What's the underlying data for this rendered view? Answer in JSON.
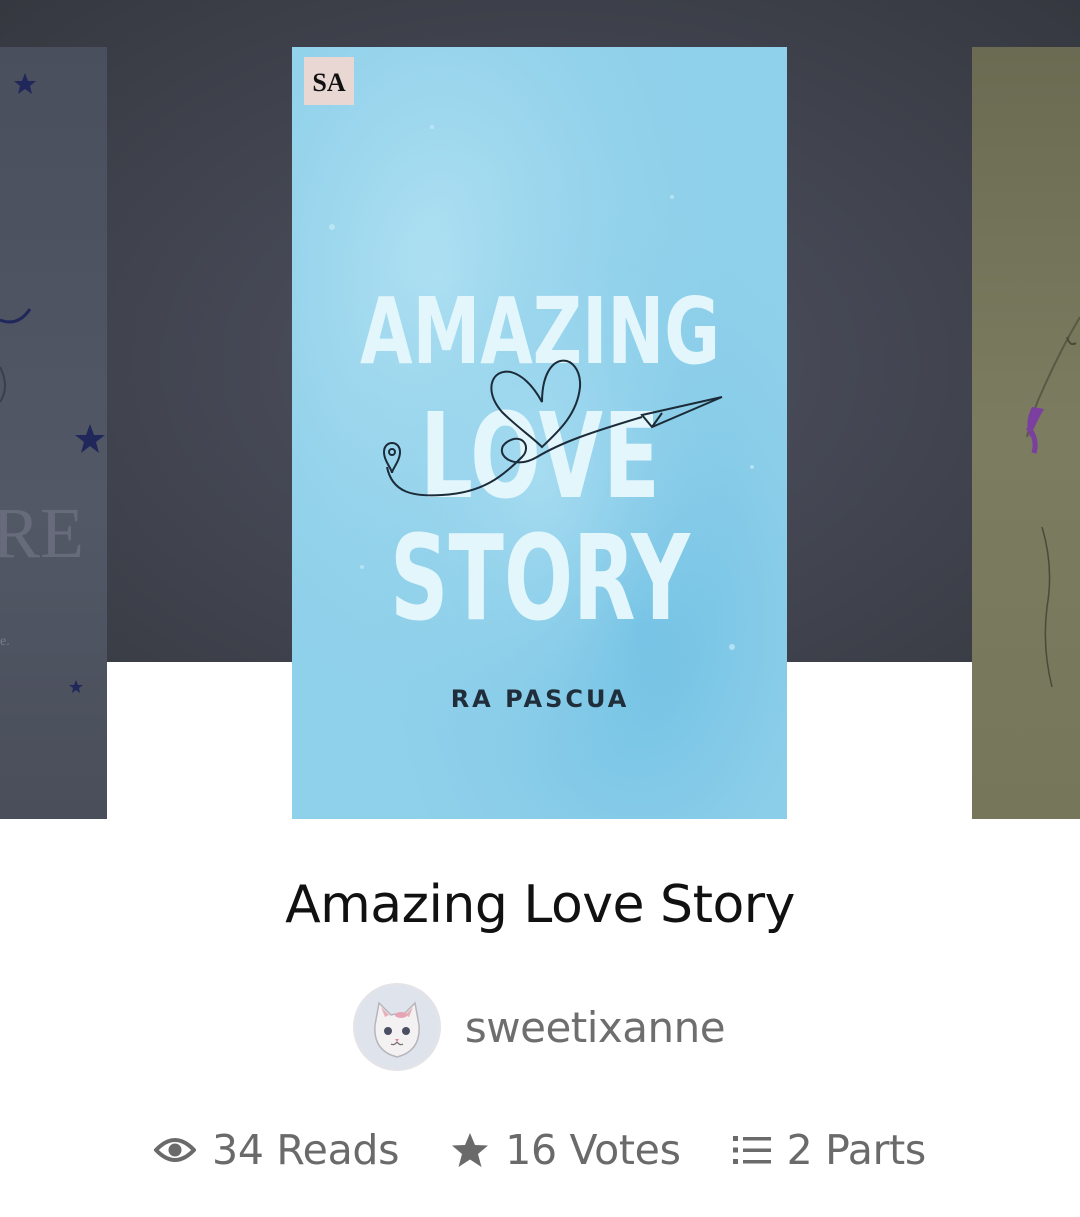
{
  "carousel": {
    "left_cover_fragment": "RE",
    "main_cover": {
      "publisher_badge": "SA",
      "cover_title_lines": [
        "AMAZING",
        "LOVE",
        "STORY"
      ],
      "cover_author": "RA PASCUA",
      "bg_color": "#8fd0ea"
    }
  },
  "book": {
    "title": "Amazing Love Story"
  },
  "author": {
    "username": "sweetixanne",
    "avatar_icon": "cat-avatar"
  },
  "stats": {
    "reads": "34 Reads",
    "votes": "16 Votes",
    "parts": "2 Parts",
    "icons": [
      "eye-icon",
      "star-icon",
      "list-icon"
    ],
    "icon_color": "#6a6a6a"
  }
}
